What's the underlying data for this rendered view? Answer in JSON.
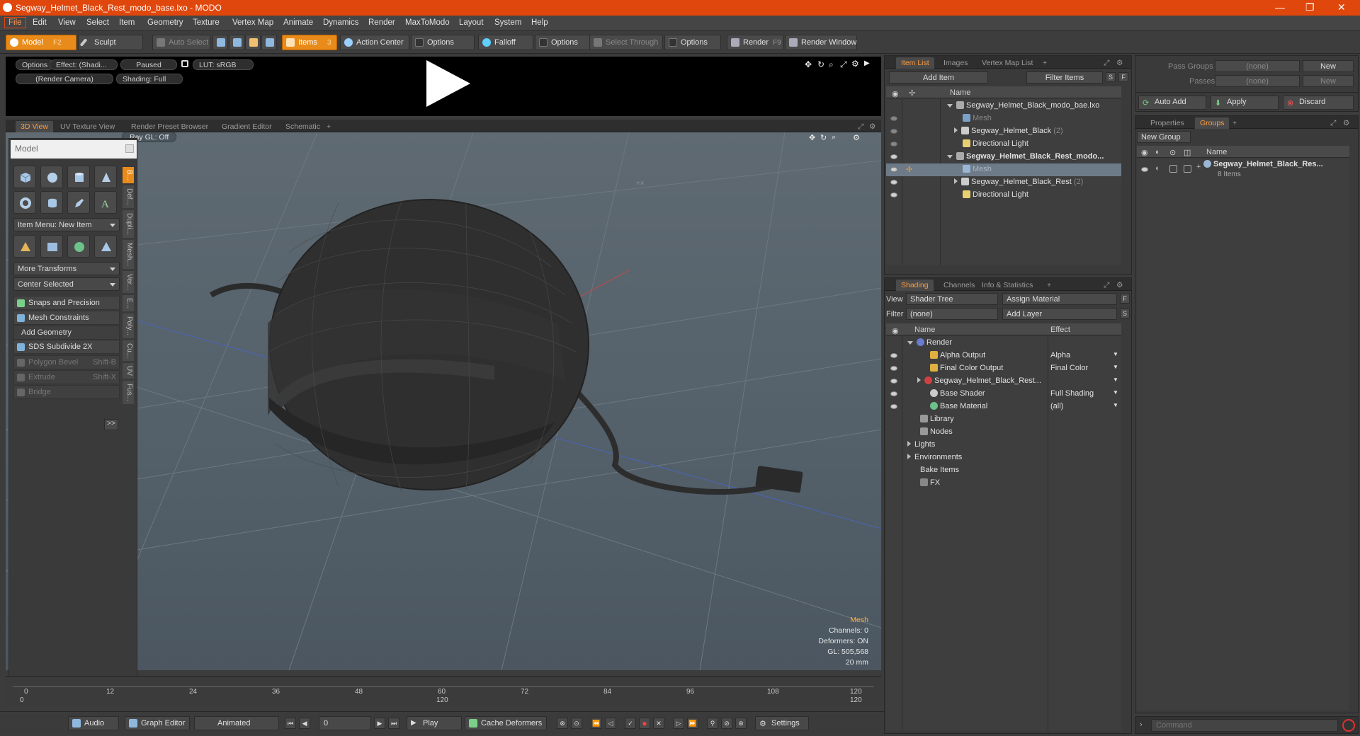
{
  "window": {
    "title": "Segway_Helmet_Black_Rest_modo_base.lxo - MODO",
    "min_icon": "minimize-icon",
    "max_icon": "maximize-icon",
    "close_icon": "close-icon"
  },
  "menu": [
    "File",
    "Edit",
    "View",
    "Select",
    "Item",
    "Geometry",
    "Texture",
    "Vertex Map",
    "Animate",
    "Dynamics",
    "Render",
    "MaxToModo",
    "Layout",
    "System",
    "Help"
  ],
  "toolbar": {
    "model": "Model",
    "model_key": "F2",
    "sculpt": "Sculpt",
    "auto_select": "Auto Select",
    "items": "Items",
    "items_key": "3",
    "action_center": "Action Center",
    "options1": "Options",
    "falloff": "Falloff",
    "options2": "Options",
    "select_through": "Select Through",
    "options3": "Options",
    "render": "Render",
    "render_key": "F9",
    "render_window": "Render Window"
  },
  "preview": {
    "options": "Options",
    "effect": "Effect: (Shadi...",
    "paused": "Paused",
    "lut": "LUT: sRGB",
    "camera": "(Render Camera)",
    "shading": "Shading: Full"
  },
  "view_tabs": [
    "3D View",
    "UV Texture View",
    "Render Preset Browser",
    "Gradient Editor",
    "Schematic"
  ],
  "viewport": {
    "raygl": "Ray GL: Off",
    "hud": {
      "mode": "Mesh",
      "channels": "Channels: 0",
      "deformers": "Deformers: ON",
      "gl": "GL: 505,568",
      "scale": "20 mm"
    }
  },
  "tool_panel": {
    "header": "Model",
    "item_menu": "Item Menu: New Item",
    "more_transforms": "More Transforms",
    "center_selected": "Center Selected",
    "snaps": "Snaps and Precision",
    "mesh_constraints": "Mesh Constraints",
    "add_geometry": "Add Geometry",
    "sds": "SDS Subdivide 2X",
    "polygon_bevel": "Polygon Bevel",
    "polygon_bevel_key": "Shift-B",
    "extrude": "Extrude",
    "extrude_key": "Shift-X",
    "bridge": "Bridge",
    "more": ">>",
    "vtabs": [
      "B...",
      "Def...",
      "Dupli...",
      "Mesh...",
      "Ver...",
      "E...",
      "Poly...",
      "Cu...",
      "UV",
      "Fus..."
    ]
  },
  "timeline": {
    "ticks_top": [
      "0",
      "12",
      "24",
      "36",
      "48",
      "60",
      "72",
      "84",
      "96",
      "108",
      "120"
    ],
    "ticks_bottom": [
      "0",
      "120",
      "120"
    ]
  },
  "transport": {
    "audio": "Audio",
    "graph_editor": "Graph Editor",
    "animated": "Animated",
    "frame": "0",
    "play": "Play",
    "cache": "Cache Deformers",
    "settings": "Settings"
  },
  "item_list": {
    "tabs": [
      "Item List",
      "Images",
      "Vertex Map List"
    ],
    "add_item": "Add Item",
    "filter_items": "Filter Items",
    "s_btn": "S",
    "f_btn": "F",
    "col_name": "Name",
    "rows": [
      {
        "label": "Segway_Helmet_Black_modo_bae.lxo",
        "count": ""
      },
      {
        "label": "Mesh",
        "count": ""
      },
      {
        "label": "Segway_Helmet_Black",
        "count": "(2)"
      },
      {
        "label": "Directional Light",
        "count": ""
      },
      {
        "label": "Segway_Helmet_Black_Rest_modo...",
        "count": ""
      },
      {
        "label": "Mesh",
        "count": ""
      },
      {
        "label": "Segway_Helmet_Black_Rest",
        "count": "(2)"
      },
      {
        "label": "Directional Light",
        "count": ""
      }
    ]
  },
  "shading": {
    "tabs": [
      "Shading",
      "Channels",
      "Info & Statistics"
    ],
    "view_label": "View",
    "view_value": "Shader Tree",
    "assign_material": "Assign Material",
    "f_btn": "F",
    "filter_label": "Filter",
    "filter_value": "(none)",
    "add_layer": "Add Layer",
    "s_btn": "S",
    "col_name": "Name",
    "col_effect": "Effect",
    "rows": [
      {
        "name": "Render",
        "effect": ""
      },
      {
        "name": "Alpha Output",
        "effect": "Alpha"
      },
      {
        "name": "Final Color Output",
        "effect": "Final Color"
      },
      {
        "name": "Segway_Helmet_Black_Rest...",
        "effect": ""
      },
      {
        "name": "Base Shader",
        "effect": "Full Shading"
      },
      {
        "name": "Base Material",
        "effect": "(all)"
      },
      {
        "name": "Library",
        "effect": ""
      },
      {
        "name": "Nodes",
        "effect": ""
      },
      {
        "name": "Lights",
        "effect": ""
      },
      {
        "name": "Environments",
        "effect": ""
      },
      {
        "name": "Bake Items",
        "effect": ""
      },
      {
        "name": "FX",
        "effect": ""
      }
    ]
  },
  "pass_panel": {
    "pass_groups_label": "Pass Groups",
    "pass_groups_value": "(none)",
    "new1": "New",
    "passes_label": "Passes",
    "passes_value": "(none)",
    "new2": "New",
    "auto_add": "Auto Add",
    "apply": "Apply",
    "discard": "Discard"
  },
  "groups": {
    "tabs": [
      "Properties",
      "Groups"
    ],
    "new_group": "New Group",
    "col_name": "Name",
    "group_name": "Segway_Helmet_Black_Res...",
    "group_items": "8 Items"
  },
  "command": {
    "placeholder": "Command"
  },
  "colors": {
    "accent": "#e88b1a",
    "title": "#e0470c",
    "selection": "#6d7a88"
  }
}
